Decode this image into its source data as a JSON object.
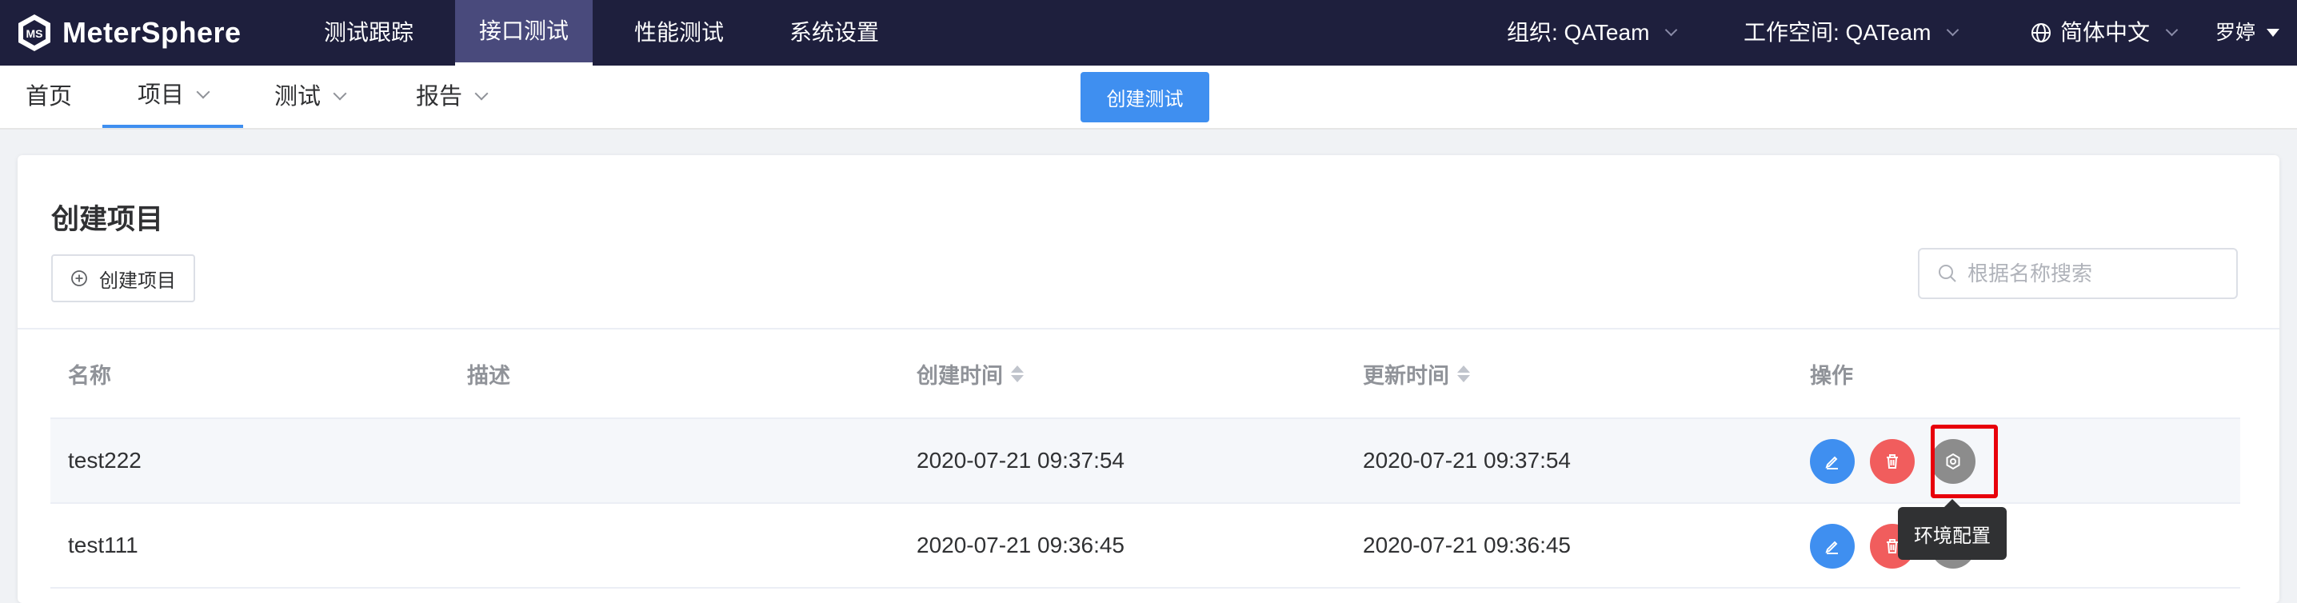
{
  "app": {
    "brand": "MeterSphere",
    "top_nav": [
      {
        "label": "测试跟踪",
        "active": false
      },
      {
        "label": "接口测试",
        "active": true
      },
      {
        "label": "性能测试",
        "active": false
      },
      {
        "label": "系统设置",
        "active": false
      }
    ],
    "org_label": "组织: QATeam",
    "workspace_label": "工作空间: QATeam",
    "language_label": "简体中文",
    "user_label": "罗婷"
  },
  "sub_nav": {
    "items": [
      {
        "label": "首页",
        "active": false
      },
      {
        "label": "项目",
        "active": true
      },
      {
        "label": "测试",
        "active": false
      },
      {
        "label": "报告",
        "active": false
      }
    ],
    "create_test_label": "创建测试"
  },
  "project_panel": {
    "title": "创建项目",
    "create_button_label": "创建项目",
    "search_placeholder": "根据名称搜索",
    "columns": [
      "名称",
      "描述",
      "创建时间",
      "更新时间",
      "操作"
    ],
    "rows": [
      {
        "name": "test222",
        "description": "",
        "created": "2020-07-21 09:37:54",
        "updated": "2020-07-21 09:37:54"
      },
      {
        "name": "test111",
        "description": "",
        "created": "2020-07-21 09:36:45",
        "updated": "2020-07-21 09:36:45"
      }
    ],
    "tooltip": "环境配置"
  },
  "icons": {
    "logo": "metersphere-logo-icon",
    "language": "globe-icon",
    "create": "plus-circle-icon",
    "search": "search-icon",
    "edit": "edit-icon",
    "delete": "trash-icon",
    "environment": "gear-icon"
  },
  "colors": {
    "topbar_bg": "#1e1f3d",
    "active_nav_bg": "#494a7c",
    "primary": "#3f8ff0",
    "danger": "#f15d5d",
    "env_button": "#8c8c8c",
    "highlight_box": "#e8000b"
  }
}
